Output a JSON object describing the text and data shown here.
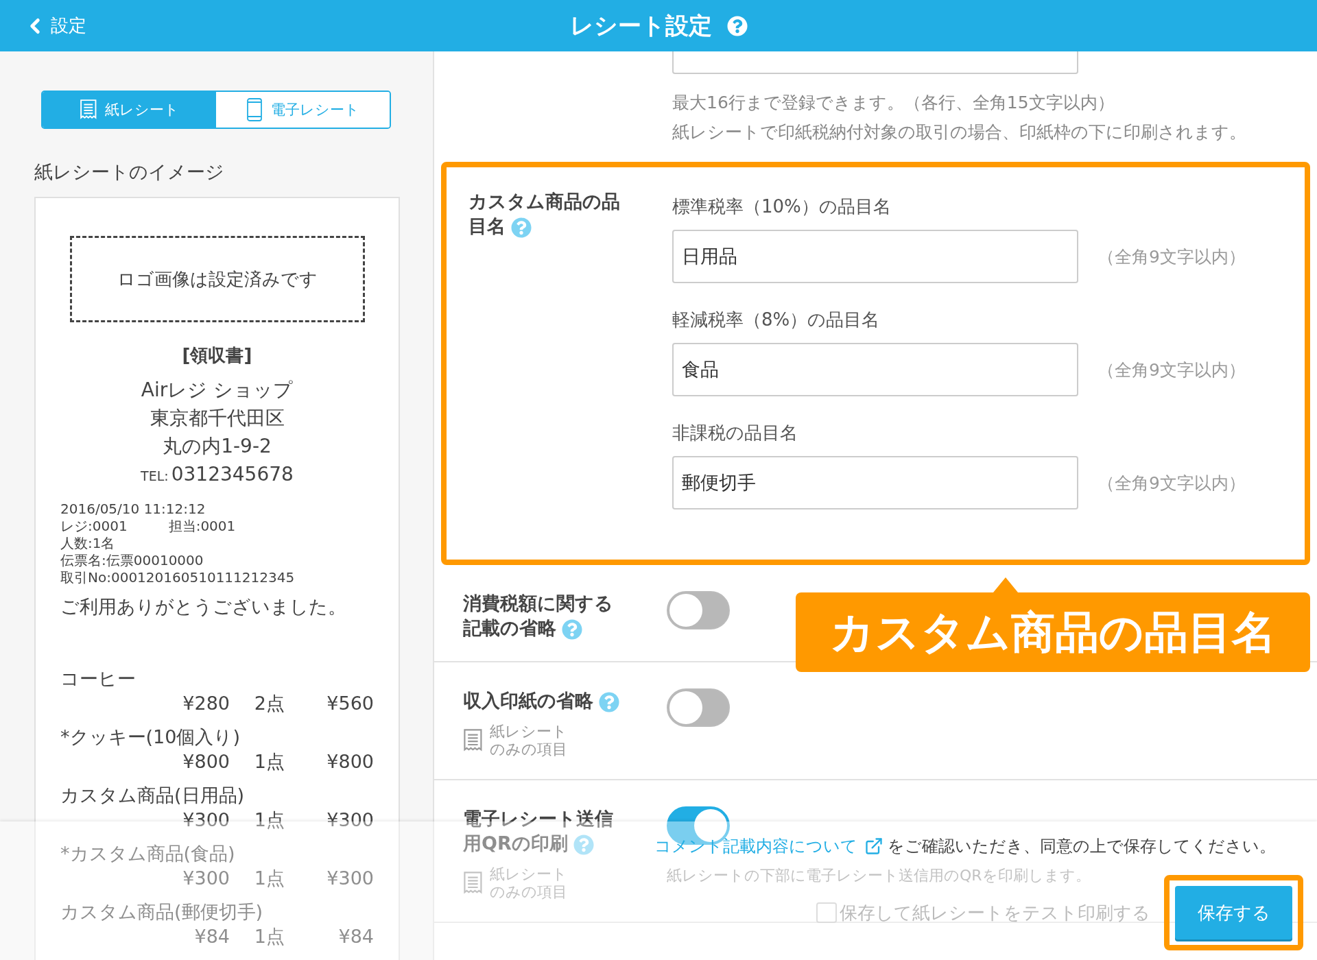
{
  "header": {
    "back_label": "設定",
    "title": "レシート設定"
  },
  "receipt_tabs": [
    {
      "label": "紙レシート",
      "selected": true
    },
    {
      "label": "電子レシート",
      "selected": false
    }
  ],
  "preview": {
    "heading": "紙レシートのイメージ",
    "logo_text": "ロゴ画像は設定済みです",
    "title": "[領収書]",
    "shop": "Airレジ ショップ",
    "address": [
      "東京都千代田区",
      "丸の内1-9-2"
    ],
    "tel_label": "TEL:",
    "tel": "0312345678",
    "details": [
      [
        "2016/05/10 11:12:12"
      ],
      [
        "レジ:0001",
        "担当:0001"
      ],
      [
        "人数:1名"
      ],
      [
        "伝票名:伝票00010000"
      ],
      [
        "取引No:000120160510111212345"
      ]
    ],
    "thanks": "ご利用ありがとうございました。",
    "items": [
      {
        "name": "コーヒー",
        "price": "¥280",
        "qty": "2点",
        "total": "¥560"
      },
      {
        "name": "*クッキー(10個入り)",
        "price": "¥800",
        "qty": "1点",
        "total": "¥800"
      },
      {
        "name": "カスタム商品(日用品)",
        "price": "¥300",
        "qty": "1点",
        "total": "¥300"
      },
      {
        "name": "*カスタム商品(食品)",
        "price": "¥300",
        "qty": "1点",
        "total": "¥300"
      },
      {
        "name": "カスタム商品(郵便切手)",
        "price": "¥84",
        "qty": "1点",
        "total": "¥84"
      }
    ]
  },
  "top_hint": [
    "最大16行まで登録できます。（各行、全角15文字以内）",
    "紙レシートで印紙税納付対象の取引の場合、印紙枠の下に印刷されます。"
  ],
  "sections": [
    {
      "kind": "fields",
      "label": "カスタム商品の品目名",
      "highlighted": true,
      "fields": [
        {
          "label": "標準税率（10%）の品目名",
          "value": "日用品",
          "note": "（全角9文字以内）"
        },
        {
          "label": "軽減税率（8%）の品目名",
          "value": "食品",
          "note": "（全角9文字以内）"
        },
        {
          "label": "非課税の品目名",
          "value": "郵便切手",
          "note": "（全角9文字以内）"
        }
      ]
    },
    {
      "kind": "toggle",
      "label": "消費税額に関する記載の省略",
      "on": false,
      "callout": "カスタム商品の品目名"
    },
    {
      "kind": "toggle",
      "label": "収入印紙の省略",
      "on": false,
      "paper_only": "紙レシートのみの項目"
    },
    {
      "kind": "toggle",
      "label": "電子レシート送信用QRの印刷",
      "on": true,
      "paper_only": "紙レシートのみの項目",
      "description": "紙レシートの下部に電子レシート送信用のQRを印刷します。"
    }
  ],
  "footer": {
    "notice_link": "コメント記載内容について",
    "notice_text": "をご確認いただき、同意の上で保存してください。",
    "test_print": {
      "label": "保存して紙レシートをテスト印刷する",
      "checked": false
    },
    "save_button": {
      "label": "保存する",
      "highlighted": true
    }
  }
}
